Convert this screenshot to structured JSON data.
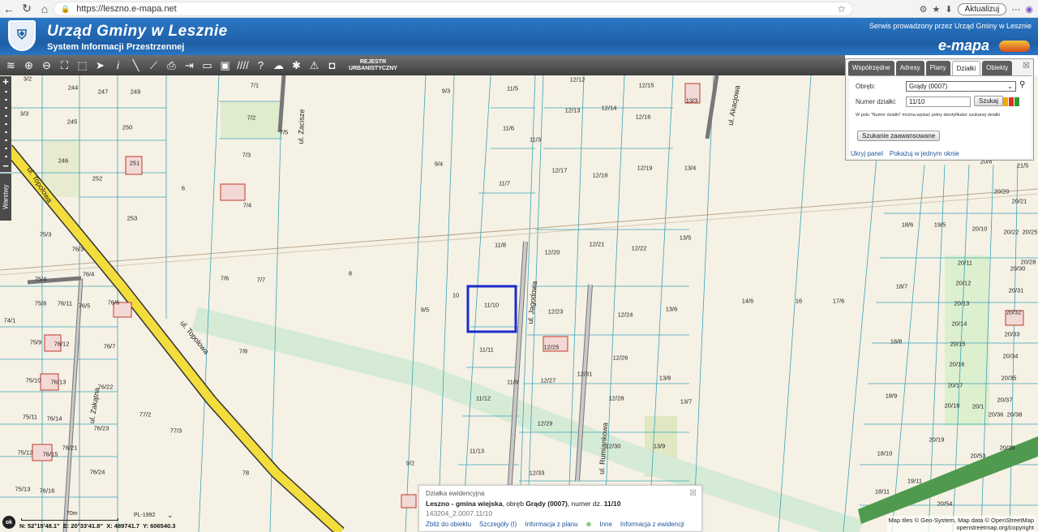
{
  "browser": {
    "url": "https://leszno.e-mapa.net",
    "update_label": "Aktualizuj"
  },
  "header": {
    "title": "Urząd Gminy w Lesznie",
    "subtitle": "System Informacji Przestrzennej",
    "serwis": "Serwis prowadzony przez Urząd Gminy w Lesznie",
    "brand": "e-mapa"
  },
  "toolbar": {
    "icons": [
      "layers-icon",
      "zoom-in-icon",
      "zoom-out-icon",
      "zoom-extent-icon",
      "pan-icon",
      "pointer-icon",
      "info-icon",
      "measure-line-icon",
      "measure-area-icon",
      "print-icon",
      "export-icon",
      "window-icon",
      "hatch-icon",
      "help-icon",
      "map-link-icon",
      "settings-icon",
      "coordinate-icon",
      "legend-icon"
    ],
    "rejestr_label": "REJESTR URBANISTYCZNY"
  },
  "left": {
    "warstwy": "Warstwy"
  },
  "panel": {
    "tabs": [
      "Współrzędne",
      "Adresy",
      "Plany",
      "Działki",
      "Obiekty"
    ],
    "active_tab": "Działki",
    "obreb_label": "Obręb:",
    "obreb_value": "Grądy (0007)",
    "numer_label": "Numer działki:",
    "numer_value": "11/10",
    "search_btn": "Szukaj",
    "hint": "W polu \"Numer działki\" można wpisać pełny identyfikator szukanej działki",
    "advanced_btn": "Szukanie zaawansowane",
    "hide_link": "Ukryj panel",
    "window_link": "Pokażuj w jednym oknie",
    "swatch_colors": [
      "#f6a800",
      "#e03020",
      "#2f9a2f"
    ]
  },
  "popup": {
    "title": "Działka ewidencyjna",
    "line_prefix": "Leszno - gmina wiejska",
    "line_mid": ", obręb ",
    "obreb": "Grądy (0007)",
    "line_nr": ", numer dz. ",
    "numer": "11/10",
    "id": "143204_2.0007.11/10",
    "links": [
      "Zbliż do obiektu",
      "Szczegóły (I)",
      "Informacja z planu",
      "Inne",
      "Informacja z ewidencji"
    ]
  },
  "scale": {
    "label": "70m",
    "crs": "PL-1992"
  },
  "coords": {
    "n": "N: 52°15'48.1\"",
    "e": "E: 20°33'41.8\"",
    "x": "X: 489741.7",
    "y": "Y: 606540.3"
  },
  "attribution": {
    "line1": "Map tiles © Geo-System, Map data © OpenStreetMap",
    "line2": "openstreetmap.org/copyright"
  },
  "map": {
    "streets": [
      "ul. Topolowa",
      "ul. Topolowa",
      "ul. Jagodowa",
      "ul. Rumiankowa",
      "ul. Zakątna",
      "ul. Zacisze",
      "ul. Akacjowa"
    ],
    "parcels": [
      "3/2",
      "244",
      "247",
      "249",
      "3/3",
      "245",
      "250",
      "246",
      "251",
      "252",
      "6",
      "253",
      "7/1",
      "7/2",
      "7/5",
      "7/3",
      "7/4",
      "75/3",
      "76/3",
      "75/4",
      "76/4",
      "75/8",
      "76/11",
      "76/5",
      "76/6",
      "74/1",
      "75/9",
      "76/12",
      "76/7",
      "75/10",
      "76/13",
      "76/22",
      "75/11",
      "76/14",
      "76/23",
      "77/2",
      "77/3",
      "75/12",
      "76/15",
      "76/21",
      "76/24",
      "75/13",
      "76/16",
      "7/6",
      "7/7",
      "8",
      "7/8",
      "78",
      "9/3",
      "9/4",
      "9/5",
      "10",
      "9/2",
      "11/5",
      "11/6",
      "11/3",
      "11/7",
      "11/8",
      "11/10",
      "11/11",
      "11/12",
      "11/13",
      "11/9",
      "12/12",
      "12/13",
      "12/14",
      "12/15",
      "12/16",
      "12/17",
      "12/18",
      "12/19",
      "12/20",
      "12/21",
      "12/22",
      "12/23",
      "12/24",
      "12/25",
      "12/26",
      "12/27",
      "12/28",
      "12/29",
      "12/30",
      "12/31",
      "12/33",
      "13/3",
      "13/4",
      "13/5",
      "13/6",
      "13/7",
      "13/8",
      "13/9",
      "14/6",
      "16",
      "17/6",
      "18/6",
      "18/7",
      "18/8",
      "18/9",
      "18/10",
      "18/11",
      "19/5",
      "19/11",
      "20/10",
      "20/11",
      "20/12",
      "20/13",
      "20/14",
      "20/15",
      "20/16",
      "20/17",
      "20/18",
      "20/19",
      "20/53",
      "20/54",
      "20/1",
      "20/6",
      "20/21",
      "20/22",
      "20/30",
      "20/31",
      "20/32",
      "20/33",
      "20/34",
      "20/35",
      "20/36",
      "20/37",
      "20/38",
      "20/39",
      "21/5",
      "20/20",
      "20/25",
      "20/28"
    ]
  }
}
